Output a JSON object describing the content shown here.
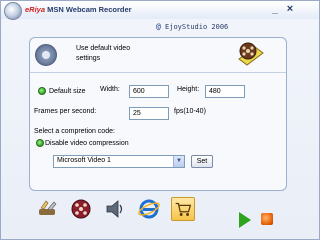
{
  "titlebar": {
    "brand": "eRiya",
    "title": " MSN Webcam Recorder",
    "minimize": "_",
    "close": "×"
  },
  "company": {
    "mark": "@",
    "text": " EjoyStudio 2006"
  },
  "header": {
    "text_line1": "Use default video",
    "text_line2": "settings"
  },
  "settings": {
    "default_size_label": "Default size",
    "width_label": "Width:",
    "width_value": "600",
    "height_label": "Height:",
    "height_value": "480",
    "fps_label": "Frames per second:",
    "fps_value": "25",
    "fps_range": "fps(10-40)",
    "codec_section_label": "Select a compretion code:",
    "disable_compression_label": "Disable video compression",
    "codec_selected": "Microsoft Video 1",
    "set_button": "Set"
  },
  "toolbar": {
    "icons": [
      "tools-icon",
      "film-reel-icon",
      "speaker-icon",
      "internet-explorer-icon",
      "shopping-cart-icon"
    ]
  },
  "colors": {
    "accent_red": "#d21e1e",
    "title_blue": "#283d6b",
    "radio_green": "#2fa51e",
    "record_orange": "#e35b00"
  }
}
